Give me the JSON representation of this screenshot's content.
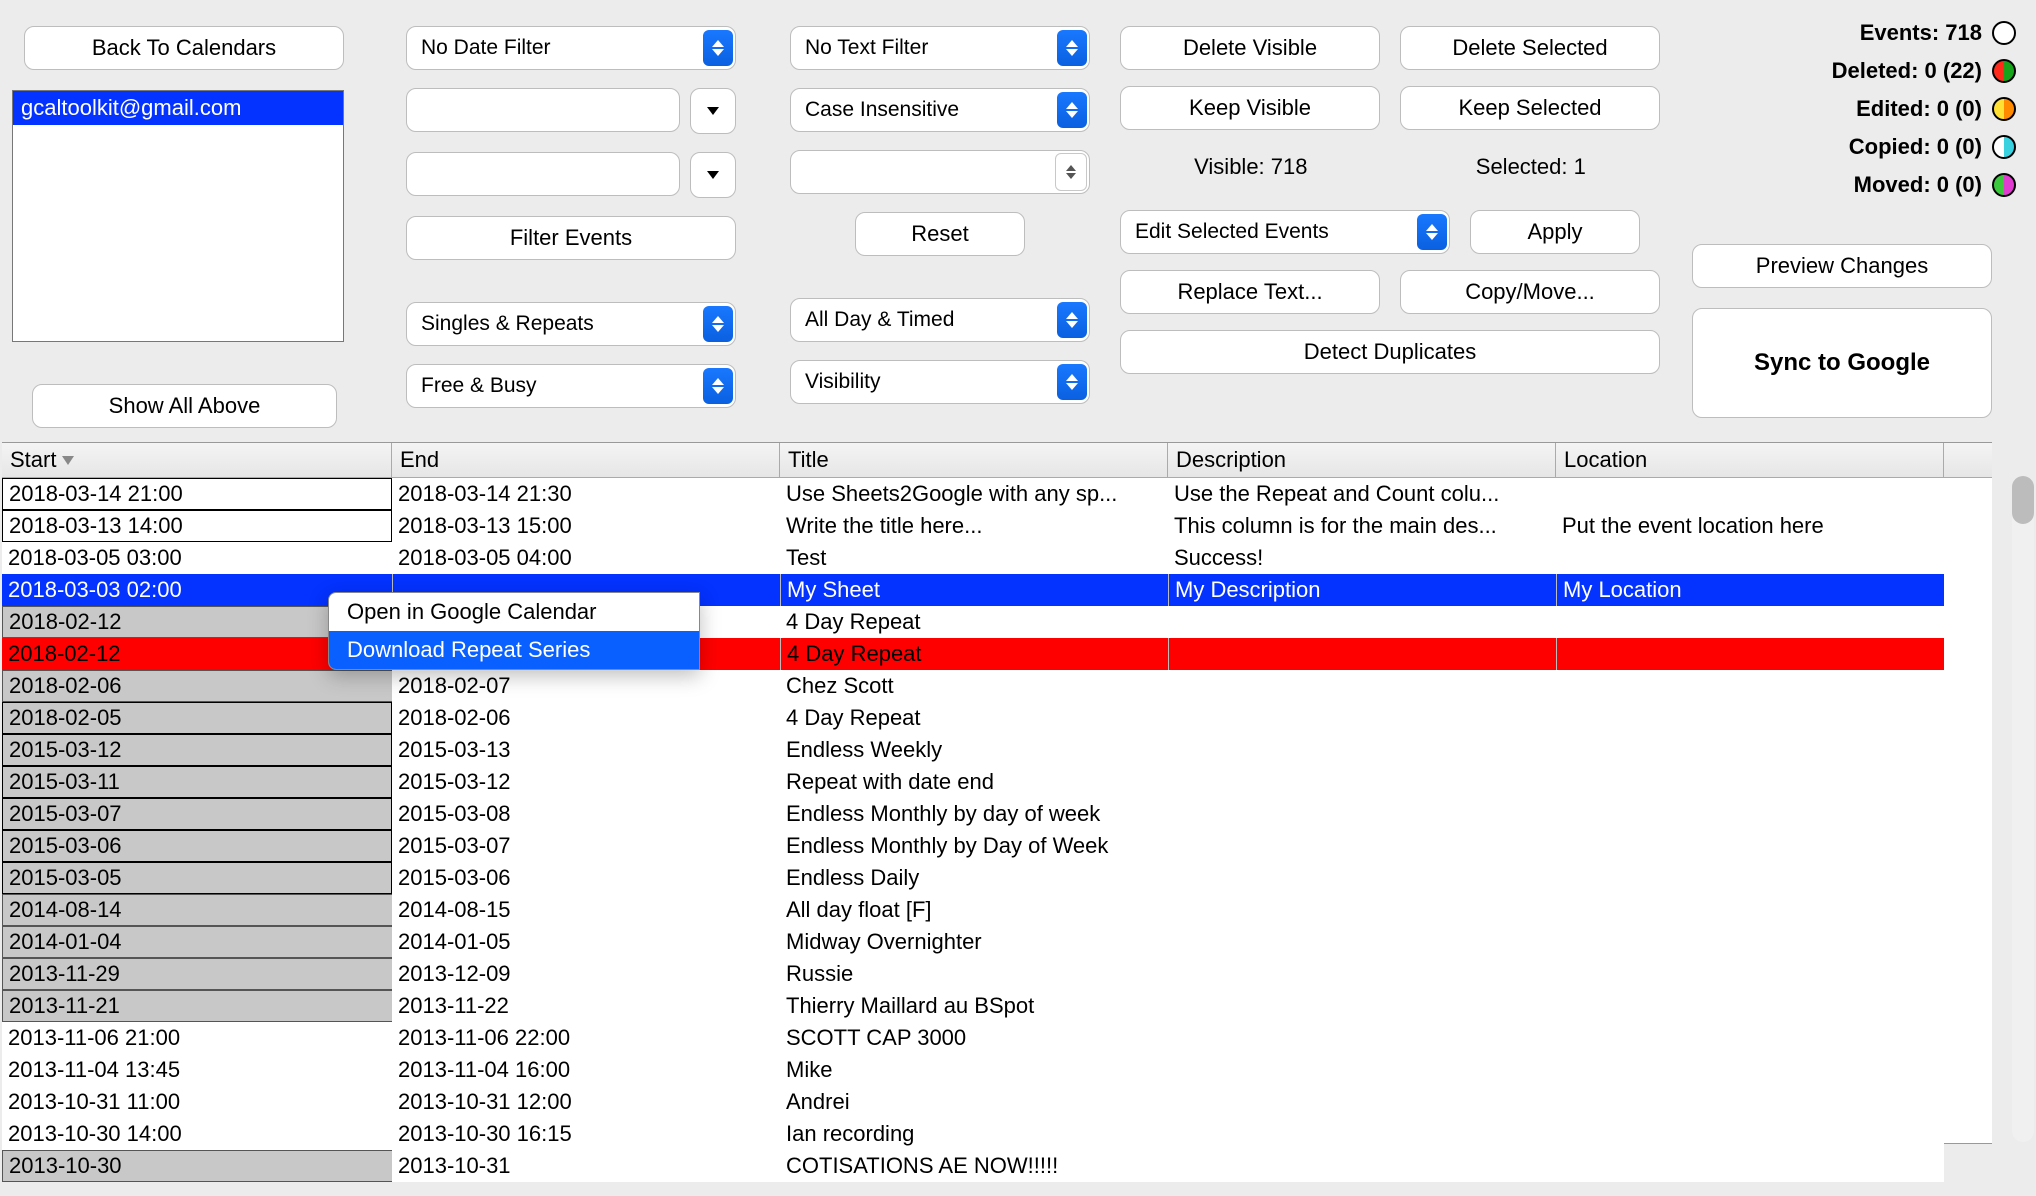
{
  "nav": {
    "back_label": "Back To Calendars",
    "show_all_label": "Show All Above"
  },
  "calendars": {
    "selected": "gcaltoolkit@gmail.com"
  },
  "filters": {
    "date_filter": "No Date Filter",
    "text_filter": "No Text Filter",
    "case_mode": "Case Insensitive",
    "filter_btn": "Filter Events",
    "reset_btn": "Reset",
    "singles_repeats": "Singles & Repeats",
    "allday_timed": "All Day & Timed",
    "free_busy": "Free & Busy",
    "visibility": "Visibility",
    "text_input1": "",
    "text_input2": "",
    "text_input3": ""
  },
  "actions": {
    "delete_visible": "Delete Visible",
    "delete_selected": "Delete Selected",
    "keep_visible": "Keep Visible",
    "keep_selected": "Keep Selected",
    "visible_label": "Visible: 718",
    "selected_label": "Selected: 1",
    "edit_selected": "Edit Selected Events",
    "apply": "Apply",
    "replace_text": "Replace Text...",
    "copy_move": "Copy/Move...",
    "detect_duplicates": "Detect Duplicates",
    "preview_changes": "Preview Changes",
    "sync": "Sync to Google"
  },
  "stats": {
    "events": "Events: 718",
    "deleted": "Deleted: 0 (22)",
    "edited": "Edited: 0 (0)",
    "copied": "Copied: 0 (0)",
    "moved": "Moved: 0 (0)"
  },
  "table": {
    "headers": {
      "start": "Start",
      "end": "End",
      "title": "Title",
      "desc": "Description",
      "loc": "Location"
    }
  },
  "rows": [
    {
      "cls": "white box",
      "start": "2018-03-14 21:00",
      "end": "2018-03-14 21:30",
      "title": "Use Sheets2Google with any sp...",
      "desc": "Use the Repeat and Count colu...",
      "loc": ""
    },
    {
      "cls": "white box",
      "start": "2018-03-13 14:00",
      "end": "2018-03-13 15:00",
      "title": "Write the title here...",
      "desc": "This column is for the main des...",
      "loc": "Put the event location here"
    },
    {
      "cls": "white",
      "start": "2018-03-05 03:00",
      "end": "2018-03-05 04:00",
      "title": "Test",
      "desc": "Success!",
      "loc": ""
    },
    {
      "cls": "blue",
      "start": "2018-03-03 02:00",
      "end": "",
      "title": "My Sheet",
      "desc": "My Description",
      "loc": "My Location"
    },
    {
      "cls": "grey",
      "start": "2018-02-12",
      "end": "",
      "title": "4 Day Repeat",
      "desc": "",
      "loc": ""
    },
    {
      "cls": "red",
      "start": "2018-02-12",
      "end": "",
      "title": "4 Day Repeat",
      "desc": "",
      "loc": ""
    },
    {
      "cls": "grey",
      "start": "2018-02-06",
      "end": "2018-02-07",
      "title": "Chez Scott",
      "desc": "",
      "loc": ""
    },
    {
      "cls": "grey box",
      "start": "2018-02-05",
      "end": "2018-02-06",
      "title": "4 Day Repeat",
      "desc": "",
      "loc": ""
    },
    {
      "cls": "grey box",
      "start": "2015-03-12",
      "end": "2015-03-13",
      "title": "Endless Weekly",
      "desc": "",
      "loc": ""
    },
    {
      "cls": "grey box",
      "start": "2015-03-11",
      "end": "2015-03-12",
      "title": "Repeat with date end",
      "desc": "",
      "loc": ""
    },
    {
      "cls": "grey box",
      "start": "2015-03-07",
      "end": "2015-03-08",
      "title": "Endless Monthly by day of week",
      "desc": "",
      "loc": ""
    },
    {
      "cls": "grey box",
      "start": "2015-03-06",
      "end": "2015-03-07",
      "title": "Endless Monthly by Day of Week",
      "desc": "",
      "loc": ""
    },
    {
      "cls": "grey box",
      "start": "2015-03-05",
      "end": "2015-03-06",
      "title": "Endless Daily",
      "desc": "",
      "loc": ""
    },
    {
      "cls": "grey",
      "start": "2014-08-14",
      "end": "2014-08-15",
      "title": "All day float [F]",
      "desc": "",
      "loc": ""
    },
    {
      "cls": "grey",
      "start": "2014-01-04",
      "end": "2014-01-05",
      "title": "Midway Overnighter",
      "desc": "",
      "loc": ""
    },
    {
      "cls": "grey",
      "start": "2013-11-29",
      "end": "2013-12-09",
      "title": "Russie",
      "desc": "",
      "loc": ""
    },
    {
      "cls": "grey",
      "start": "2013-11-21",
      "end": "2013-11-22",
      "title": "Thierry Maillard au BSpot",
      "desc": "",
      "loc": ""
    },
    {
      "cls": "white",
      "start": "2013-11-06 21:00",
      "end": "2013-11-06 22:00",
      "title": "SCOTT CAP 3000",
      "desc": "",
      "loc": ""
    },
    {
      "cls": "white",
      "start": "2013-11-04 13:45",
      "end": "2013-11-04 16:00",
      "title": "Mike",
      "desc": "",
      "loc": ""
    },
    {
      "cls": "white",
      "start": "2013-10-31 11:00",
      "end": "2013-10-31 12:00",
      "title": "Andrei",
      "desc": "",
      "loc": ""
    },
    {
      "cls": "white",
      "start": "2013-10-30 14:00",
      "end": "2013-10-30 16:15",
      "title": "Ian recording",
      "desc": "",
      "loc": ""
    },
    {
      "cls": "grey",
      "start": "2013-10-30",
      "end": "2013-10-31",
      "title": "COTISATIONS AE NOW!!!!!",
      "desc": "",
      "loc": ""
    }
  ],
  "context_menu": {
    "open": "Open in Google Calendar",
    "download": "Download Repeat Series"
  }
}
